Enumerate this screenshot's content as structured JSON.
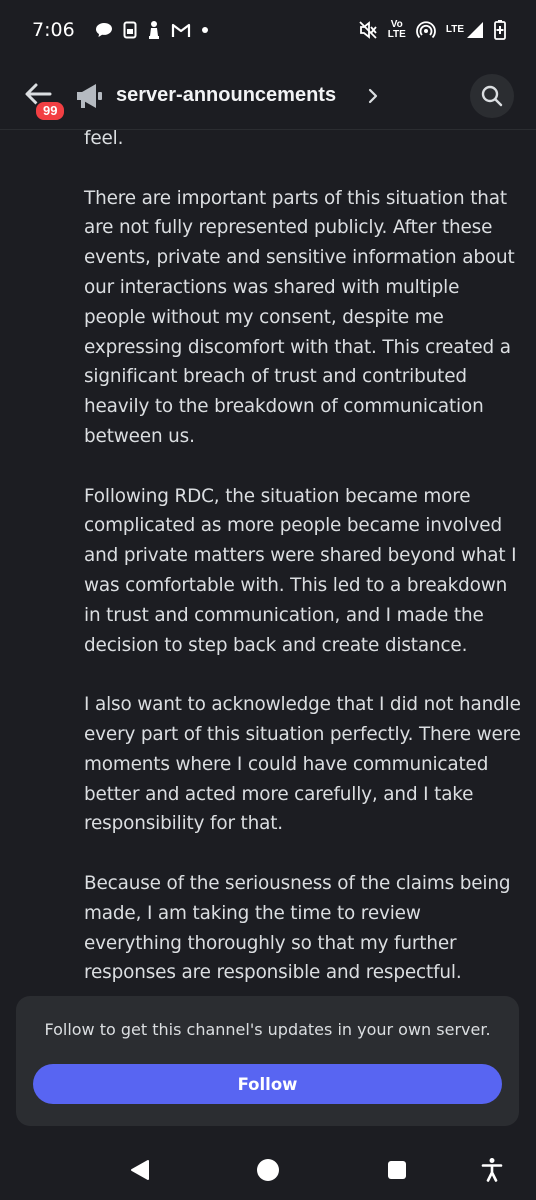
{
  "status_bar": {
    "time": "7:06",
    "lte_top": "Vo",
    "lte_bottom": "LTE",
    "network": "LTE"
  },
  "header": {
    "unread_badge": "99",
    "channel_name": "server-announcements",
    "icons": [
      "back-arrow-icon",
      "megaphone-icon",
      "chevron-right-icon",
      "search-icon"
    ]
  },
  "message": {
    "paragraphs": [
      "feel.",
      "There are important parts of this situation that are not fully represented publicly. After these events, private and sensitive information about our interactions was shared with multiple people without my consent, despite me expressing discomfort with that. This created a significant breach of trust and contributed heavily to the breakdown of communication between us.",
      "Following RDC, the situation became more complicated as more people became involved and private matters were shared beyond what I was comfortable with. This led to a breakdown in trust and communication, and I made the decision to step back and create distance.",
      "I also want to acknowledge that I did not handle every part of this situation perfectly. There were moments where I could have communicated better and acted more carefully, and I take responsibility for that.",
      "Because of the seriousness of the claims being made, I am taking the time to review everything thoroughly so that my further responses are responsible and respectful."
    ]
  },
  "follow_panel": {
    "text": "Follow to get this channel's updates in your own server.",
    "button_label": "Follow"
  },
  "colors": {
    "background": "#1c1d22",
    "accent": "#5865f2",
    "badge": "#f23f43",
    "panel": "#2b2d31"
  }
}
